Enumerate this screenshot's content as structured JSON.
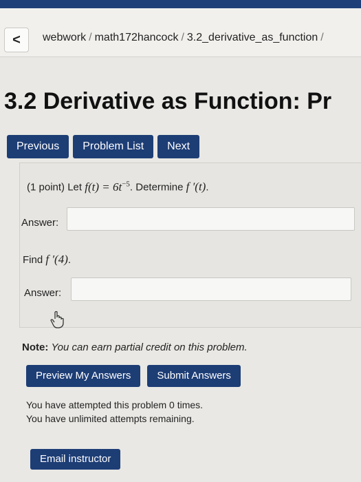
{
  "breadcrumb": {
    "back_glyph": "<",
    "items": [
      "webwork",
      "math172hancock",
      "3.2_derivative_as_function"
    ],
    "separator": "/"
  },
  "page": {
    "title": "3.2 Derivative as Function: Pr"
  },
  "nav": {
    "previous": "Previous",
    "problem_list": "Problem List",
    "next": "Next"
  },
  "problem": {
    "points": "(1 point) Let",
    "func": "f(t) = 6t",
    "exponent": "−5",
    "determine": ". Determine",
    "deriv": "f ′(t)",
    "period": ".",
    "answer1_label": "Answer:",
    "answer1_value": "",
    "find_text": "Find",
    "find_expr": "f ′(4)",
    "find_period": ".",
    "answer2_label": "Answer:",
    "answer2_value": ""
  },
  "note": {
    "label": "Note:",
    "text": "You can earn partial credit on this problem."
  },
  "actions": {
    "preview": "Preview My Answers",
    "submit": "Submit Answers"
  },
  "attempts": {
    "line1": "You have attempted this problem 0 times.",
    "line2": "You have unlimited attempts remaining."
  },
  "email": {
    "label": "Email instructor"
  },
  "colors": {
    "button_bg": "#1d3d75",
    "page_bg": "#e9e8e4",
    "top_bar": "#1f3f78"
  },
  "icons": {
    "back": "chevron-left-icon",
    "cursor": "hand-pointer-icon"
  }
}
